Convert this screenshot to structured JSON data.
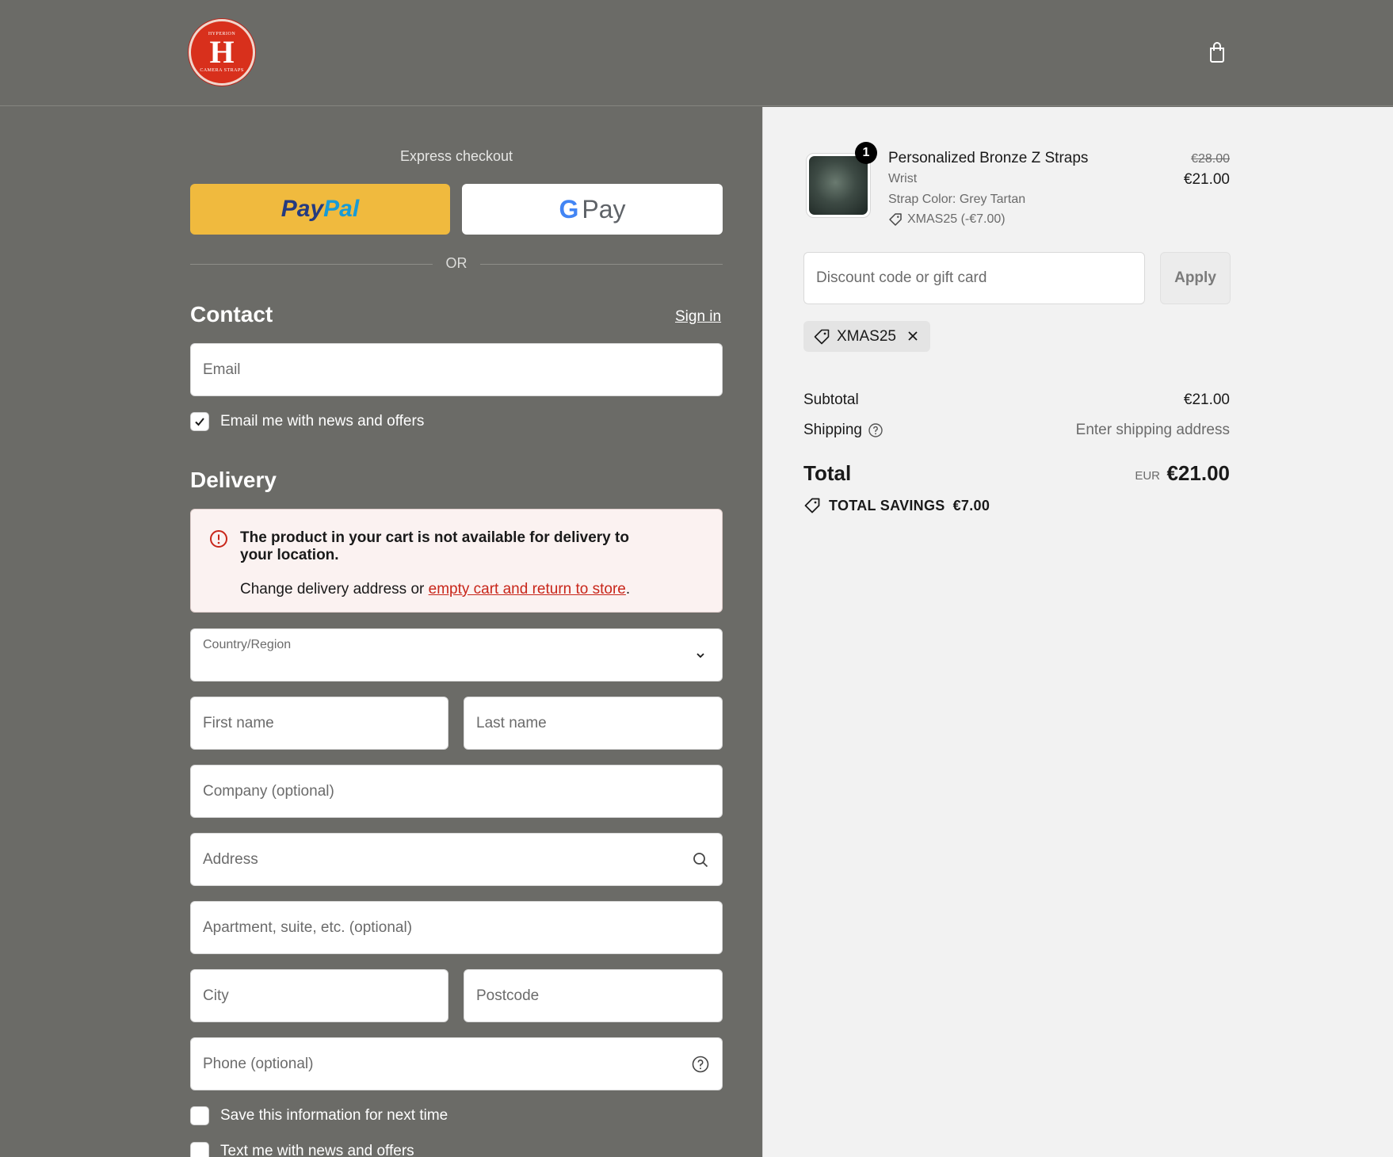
{
  "header": {
    "logo_top": "HYPERION",
    "logo_letter": "H",
    "logo_bottom": "CAMERA STRAPS"
  },
  "express": {
    "title": "Express checkout",
    "paypal_a": "Pay",
    "paypal_b": "Pal",
    "gpay_g": "G",
    "gpay_label": "Pay",
    "or": "OR"
  },
  "contact": {
    "heading": "Contact",
    "sign_in": "Sign in",
    "email_placeholder": "Email",
    "news_label": "Email me with news and offers",
    "news_checked": true
  },
  "delivery": {
    "heading": "Delivery",
    "alert_title": "The product in your cart is not available for delivery to your location.",
    "alert_body_prefix": "Change delivery address or ",
    "alert_link": "empty cart and return to store",
    "alert_body_suffix": ".",
    "country_label": "Country/Region",
    "first_name": "First name",
    "last_name": "Last name",
    "company": "Company (optional)",
    "address": "Address",
    "apartment": "Apartment, suite, etc. (optional)",
    "city": "City",
    "postcode": "Postcode",
    "phone": "Phone (optional)",
    "save_info": "Save this information for next time",
    "text_me": "Text me with news and offers"
  },
  "summary": {
    "qty": "1",
    "product_name": "Personalized Bronze Z Straps",
    "variant": "Wrist",
    "color": "Strap Color: Grey Tartan",
    "discount_line": "XMAS25 (-€7.00)",
    "old_price": "€28.00",
    "new_price": "€21.00",
    "discount_placeholder": "Discount code or gift card",
    "apply": "Apply",
    "applied_code": "XMAS25",
    "subtotal_label": "Subtotal",
    "subtotal_value": "€21.00",
    "shipping_label": "Shipping",
    "shipping_value": "Enter shipping address",
    "total_label": "Total",
    "currency": "EUR",
    "total_value": "€21.00",
    "savings_label": "TOTAL SAVINGS",
    "savings_value": "€7.00"
  }
}
